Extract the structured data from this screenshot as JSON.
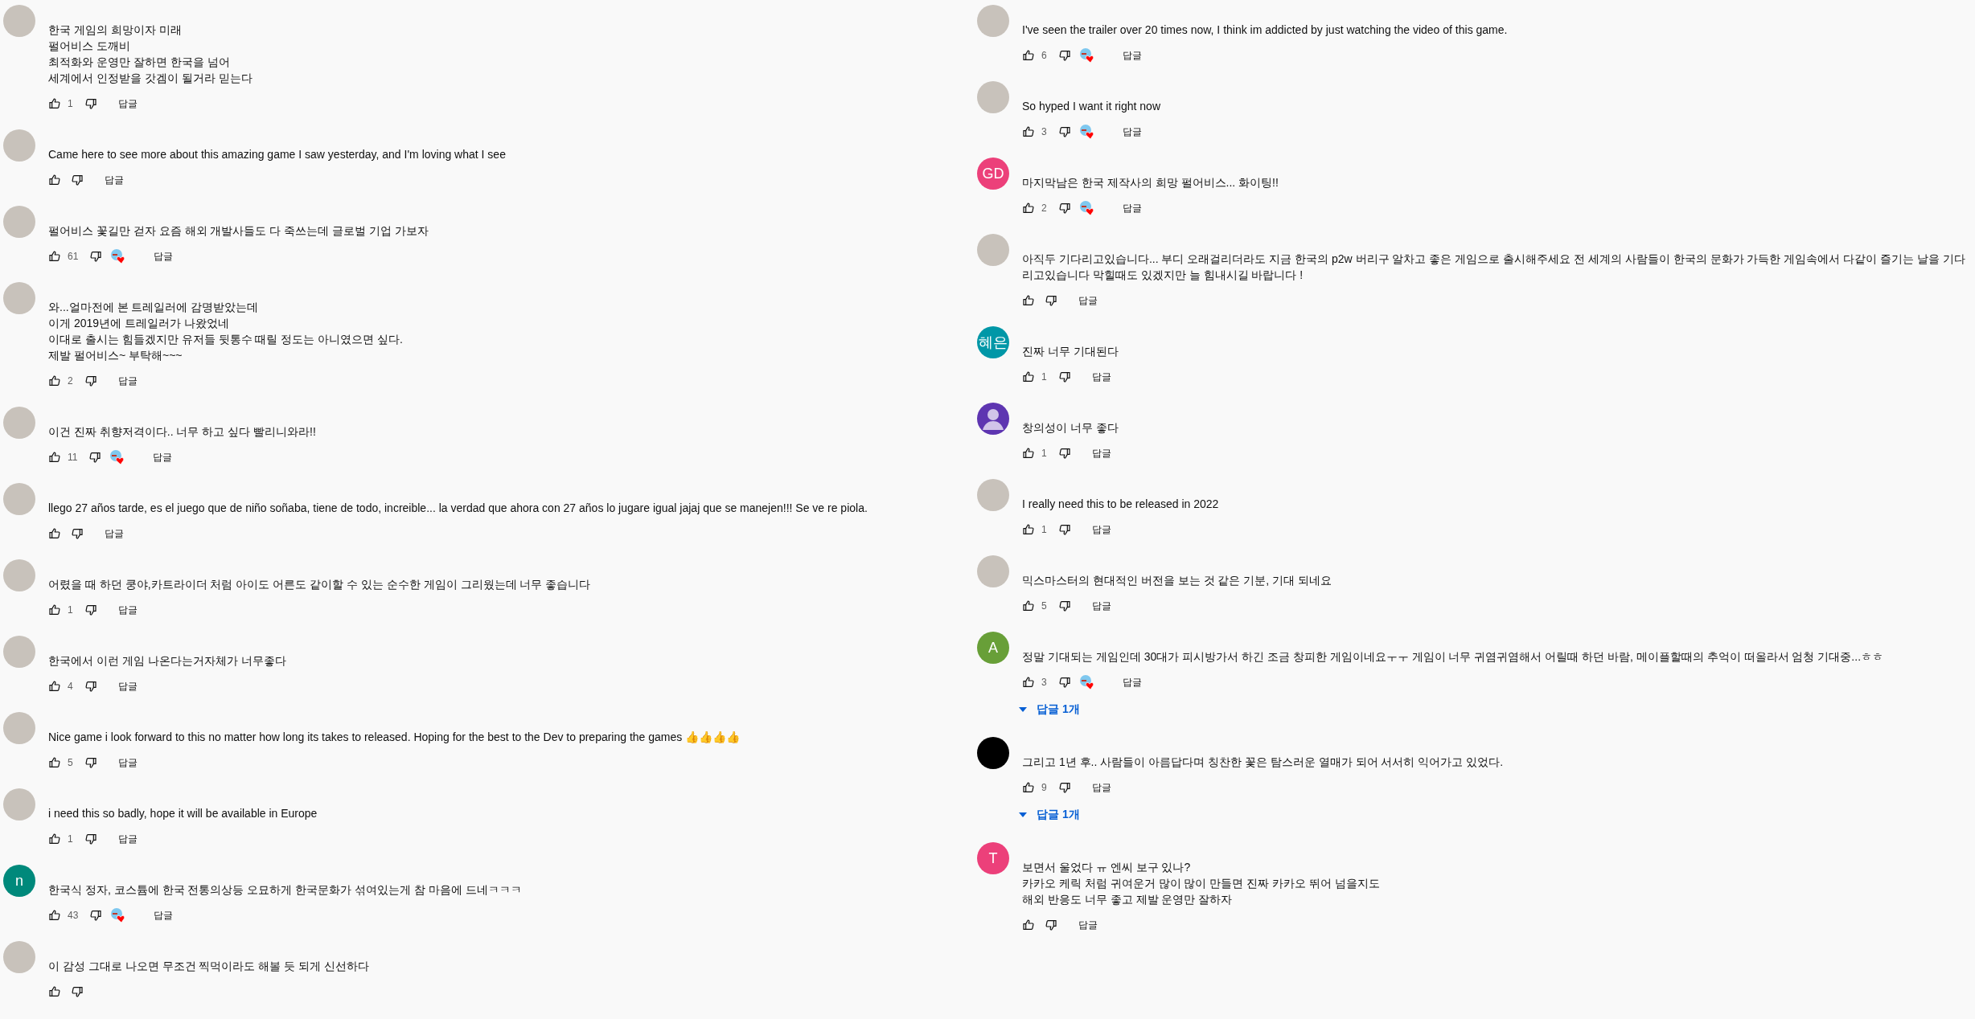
{
  "columns": [
    {
      "comments": [
        {
          "avatar": {
            "kind": "photo"
          },
          "text": [
            "한국 게임의 희망이자 미래",
            "펄어비스 도깨비",
            "최적화와 운영만 잘하면 한국을 넘어",
            "세계에서 인정받을 갓겜이 될거라 믿는다"
          ],
          "likes": "1",
          "hearted": false,
          "reply": "답글"
        },
        {
          "avatar": {
            "kind": "photo"
          },
          "text": [
            "Came here to see more about this amazing game I saw yesterday, and I'm loving what I see"
          ],
          "hearted": false,
          "reply": "답글"
        },
        {
          "avatar": {
            "kind": "photo"
          },
          "text": [
            "펄어비스 꽃길만 걷자 요즘 해외 개발사들도 다 죽쓰는데 글로벌 기업 가보자"
          ],
          "likes": "61",
          "hearted": true,
          "reply": "답글"
        },
        {
          "avatar": {
            "kind": "photo"
          },
          "text": [
            "와...얼마전에 본 트레일러에 감명받았는데",
            "이게 2019년에 트레일러가 나왔었네",
            "이대로 출시는 힘들겠지만 유저들 뒷통수 때릴 정도는 아니였으면 싶다.",
            "제발 펄어비스~ 부탁해~~~"
          ],
          "likes": "2",
          "hearted": false,
          "reply": "답글"
        },
        {
          "avatar": {
            "kind": "photo"
          },
          "text": [
            "이건 진짜 취향저격이다.. 너무 하고 싶다 빨리니와라!!"
          ],
          "likes": "11",
          "hearted": true,
          "reply": "답글"
        },
        {
          "avatar": {
            "kind": "photo"
          },
          "text": [
            "llego 27 años tarde, es el juego que de niño soñaba, tiene de todo, increible... la verdad que ahora con 27 años lo jugare igual jajaj que se manejen!!! Se ve re piola."
          ],
          "hearted": false,
          "reply": "답글"
        },
        {
          "avatar": {
            "kind": "photo"
          },
          "text": [
            "어렸을 때 하던 쿵야,카트라이더 처럼 아이도 어른도 같이할 수 있는 순수한 게임이 그리웠는데 너무 좋습니다"
          ],
          "likes": "1",
          "hearted": false,
          "reply": "답글"
        },
        {
          "avatar": {
            "kind": "photo"
          },
          "text": [
            "한국에서 이런 게임 나온다는거자체가 너무좋다"
          ],
          "likes": "4",
          "hearted": false,
          "reply": "답글"
        },
        {
          "avatar": {
            "kind": "photo"
          },
          "text": [
            "Nice game i look forward to this no matter how long its takes to released. Hoping for the best to the Dev to preparing the games 👍👍👍👍"
          ],
          "likes": "5",
          "hearted": false,
          "reply": "답글"
        },
        {
          "avatar": {
            "kind": "photo"
          },
          "text": [
            "i need this so badly, hope it will be available in Europe"
          ],
          "likes": "1",
          "hearted": false,
          "reply": "답글"
        },
        {
          "avatar": {
            "kind": "letter",
            "letter": "n",
            "color": "#00897b"
          },
          "text": [
            "한국식 정자, 코스튬에 한국 전통의상등 오묘하게 한국문화가 섞여있는게 참 마음에 드네ㅋㅋㅋ"
          ],
          "likes": "43",
          "hearted": true,
          "reply": "답글"
        },
        {
          "avatar": {
            "kind": "photo"
          },
          "text": [
            "이 감성 그대로 나오면 무조건 찍먹이라도 해볼 듯 되게 신선하다"
          ],
          "hearted": false
        }
      ]
    },
    {
      "comments": [
        {
          "avatar": {
            "kind": "photo"
          },
          "text": [
            "I've seen the trailer over 20 times now, I think im addicted by just watching the video of this game."
          ],
          "likes": "6",
          "hearted": true,
          "reply": "답글"
        },
        {
          "avatar": {
            "kind": "photo"
          },
          "text": [
            "So hyped I want it right now"
          ],
          "likes": "3",
          "hearted": true,
          "reply": "답글"
        },
        {
          "avatar": {
            "kind": "letter",
            "letter": "GD",
            "color": "#ec407a"
          },
          "text": [
            "마지막남은 한국 제작사의 희망 펄어비스... 화이팅!!"
          ],
          "likes": "2",
          "hearted": true,
          "reply": "답글"
        },
        {
          "avatar": {
            "kind": "photo"
          },
          "text": [
            "아직두 기다리고있습니다... 부디 오래걸리더라도 지금 한국의 p2w 버리구 알차고 좋은 게임으로 출시해주세요 전 세계의 사람들이 한국의 문화가 가득한 게임속에서 다같이 즐기는 날을 기다리고있습니다 막힐때도 있겠지만 늘 힘내시길 바랍니다 !"
          ],
          "hearted": false,
          "reply": "답글"
        },
        {
          "avatar": {
            "kind": "letter",
            "letter": "혜은",
            "color": "#0097a7"
          },
          "text": [
            "진짜 너무 기대된다"
          ],
          "likes": "1",
          "hearted": false,
          "reply": "답글"
        },
        {
          "avatar": {
            "kind": "silhouette",
            "color": "#5e35b1"
          },
          "text": [
            "창의성이 너무 좋다"
          ],
          "likes": "1",
          "hearted": false,
          "reply": "답글"
        },
        {
          "avatar": {
            "kind": "photo"
          },
          "text": [
            "I really need this to be released in 2022"
          ],
          "likes": "1",
          "hearted": false,
          "reply": "답글"
        },
        {
          "avatar": {
            "kind": "photo"
          },
          "text": [
            "믹스마스터의 현대적인 버전을 보는 것 같은 기분, 기대 되네요"
          ],
          "likes": "5",
          "hearted": false,
          "reply": "답글"
        },
        {
          "avatar": {
            "kind": "letter",
            "letter": "A",
            "color": "#689f38"
          },
          "text": [
            "정말 기대되는 게임인데 30대가 피시방가서 하긴 조금 창피한 게임이네요ㅜㅜ 게임이 너무 귀염귀염해서 어릴때 하던 바람, 메이플할때의 추억이 떠올라서 엄청 기대중...ㅎㅎ"
          ],
          "likes": "3",
          "hearted": true,
          "reply": "답글",
          "replies": "답글 1개"
        },
        {
          "avatar": {
            "kind": "plain",
            "color": "#000000"
          },
          "text": [
            "그리고 1년 후.. 사람들이 아름답다며 칭찬한 꽃은 탐스러운 열매가 되어 서서히 익어가고 있었다."
          ],
          "likes": "9",
          "hearted": false,
          "reply": "답글",
          "replies": "답글 1개"
        },
        {
          "avatar": {
            "kind": "letter",
            "letter": "T",
            "color": "#ec407a"
          },
          "text": [
            "보면서 울었다 ㅠ 엔씨 보구 있나?",
            "카카오 케릭 처럼 귀여운거 많이 많이 만들면 진짜 카카오 뛰어 넘을지도",
            "해외 반응도 너무 좋고 제발 운영만 잘하자"
          ],
          "hearted": false,
          "reply": "답글"
        }
      ]
    }
  ]
}
